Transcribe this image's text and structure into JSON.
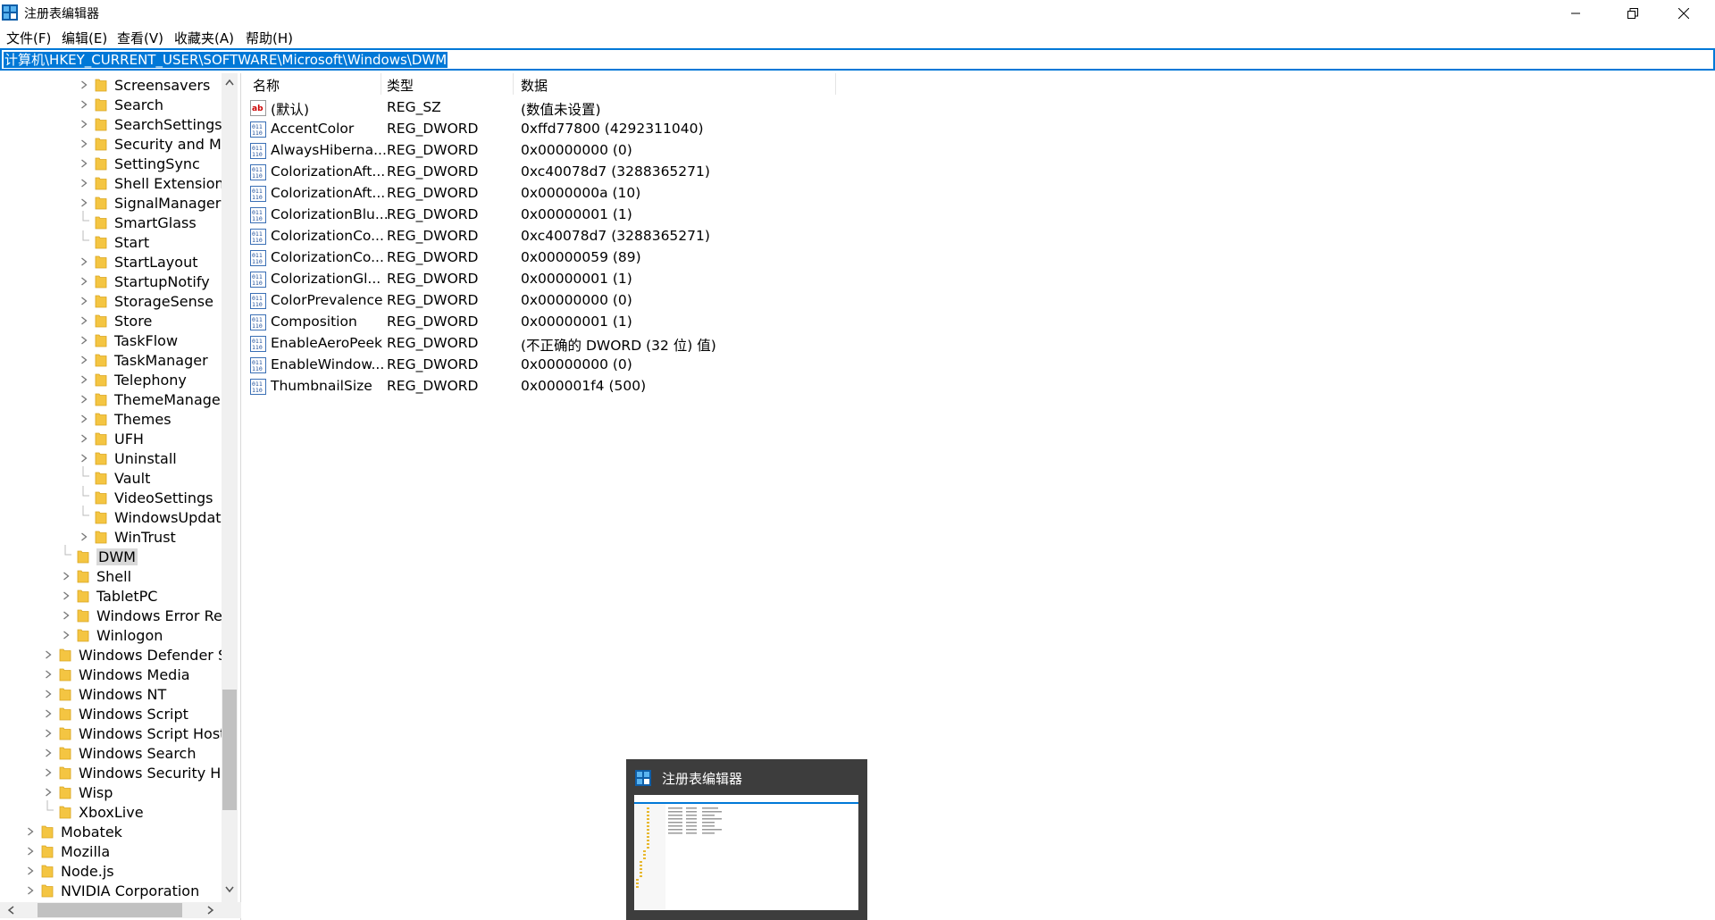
{
  "window": {
    "title": "注册表编辑器"
  },
  "menu": [
    "文件(F)",
    "编辑(E)",
    "查看(V)",
    "收藏夹(A)",
    "帮助(H)"
  ],
  "address": "计算机\\HKEY_CURRENT_USER\\SOFTWARE\\Microsoft\\Windows\\DWM",
  "tree": [
    {
      "label": "Screensavers",
      "level": 4,
      "expandable": true
    },
    {
      "label": "Search",
      "level": 4,
      "expandable": true
    },
    {
      "label": "SearchSettings",
      "level": 4,
      "expandable": true
    },
    {
      "label": "Security and Ma",
      "level": 4,
      "expandable": true
    },
    {
      "label": "SettingSync",
      "level": 4,
      "expandable": true
    },
    {
      "label": "Shell Extensions",
      "level": 4,
      "expandable": true
    },
    {
      "label": "SignalManager",
      "level": 4,
      "expandable": true
    },
    {
      "label": "SmartGlass",
      "level": 4,
      "expandable": false
    },
    {
      "label": "Start",
      "level": 4,
      "expandable": false
    },
    {
      "label": "StartLayout",
      "level": 4,
      "expandable": true
    },
    {
      "label": "StartupNotify",
      "level": 4,
      "expandable": true
    },
    {
      "label": "StorageSense",
      "level": 4,
      "expandable": true
    },
    {
      "label": "Store",
      "level": 4,
      "expandable": true
    },
    {
      "label": "TaskFlow",
      "level": 4,
      "expandable": true
    },
    {
      "label": "TaskManager",
      "level": 4,
      "expandable": true
    },
    {
      "label": "Telephony",
      "level": 4,
      "expandable": true
    },
    {
      "label": "ThemeManager",
      "level": 4,
      "expandable": true
    },
    {
      "label": "Themes",
      "level": 4,
      "expandable": true
    },
    {
      "label": "UFH",
      "level": 4,
      "expandable": true
    },
    {
      "label": "Uninstall",
      "level": 4,
      "expandable": true
    },
    {
      "label": "Vault",
      "level": 4,
      "expandable": false
    },
    {
      "label": "VideoSettings",
      "level": 4,
      "expandable": false
    },
    {
      "label": "WindowsUpdate",
      "level": 4,
      "expandable": false
    },
    {
      "label": "WinTrust",
      "level": 4,
      "expandable": true
    },
    {
      "label": "DWM",
      "level": 3,
      "expandable": false,
      "selected": true
    },
    {
      "label": "Shell",
      "level": 3,
      "expandable": true
    },
    {
      "label": "TabletPC",
      "level": 3,
      "expandable": true
    },
    {
      "label": "Windows Error Rep",
      "level": 3,
      "expandable": true
    },
    {
      "label": "Winlogon",
      "level": 3,
      "expandable": true
    },
    {
      "label": "Windows Defender Se",
      "level": 2,
      "expandable": true
    },
    {
      "label": "Windows Media",
      "level": 2,
      "expandable": true
    },
    {
      "label": "Windows NT",
      "level": 2,
      "expandable": true
    },
    {
      "label": "Windows Script",
      "level": 2,
      "expandable": true
    },
    {
      "label": "Windows Script Host",
      "level": 2,
      "expandable": true
    },
    {
      "label": "Windows Search",
      "level": 2,
      "expandable": true
    },
    {
      "label": "Windows Security He",
      "level": 2,
      "expandable": true
    },
    {
      "label": "Wisp",
      "level": 2,
      "expandable": true
    },
    {
      "label": "XboxLive",
      "level": 2,
      "expandable": false
    },
    {
      "label": "Mobatek",
      "level": 1,
      "expandable": true
    },
    {
      "label": "Mozilla",
      "level": 1,
      "expandable": true
    },
    {
      "label": "Node.js",
      "level": 1,
      "expandable": true
    },
    {
      "label": "NVIDIA Corporation",
      "level": 1,
      "expandable": true
    }
  ],
  "columns": {
    "name": "名称",
    "type": "类型",
    "data": "数据"
  },
  "values": [
    {
      "icon": "string-value-icon",
      "name": "(默认)",
      "type": "REG_SZ",
      "data": "(数值未设置)"
    },
    {
      "icon": "binary-value-icon",
      "name": "AccentColor",
      "type": "REG_DWORD",
      "data": "0xffd77800 (4292311040)"
    },
    {
      "icon": "binary-value-icon",
      "name": "AlwaysHiberna...",
      "type": "REG_DWORD",
      "data": "0x00000000 (0)"
    },
    {
      "icon": "binary-value-icon",
      "name": "ColorizationAft...",
      "type": "REG_DWORD",
      "data": "0xc40078d7 (3288365271)"
    },
    {
      "icon": "binary-value-icon",
      "name": "ColorizationAft...",
      "type": "REG_DWORD",
      "data": "0x0000000a (10)"
    },
    {
      "icon": "binary-value-icon",
      "name": "ColorizationBlu...",
      "type": "REG_DWORD",
      "data": "0x00000001 (1)"
    },
    {
      "icon": "binary-value-icon",
      "name": "ColorizationCo...",
      "type": "REG_DWORD",
      "data": "0xc40078d7 (3288365271)"
    },
    {
      "icon": "binary-value-icon",
      "name": "ColorizationCo...",
      "type": "REG_DWORD",
      "data": "0x00000059 (89)"
    },
    {
      "icon": "binary-value-icon",
      "name": "ColorizationGl...",
      "type": "REG_DWORD",
      "data": "0x00000001 (1)"
    },
    {
      "icon": "binary-value-icon",
      "name": "ColorPrevalence",
      "type": "REG_DWORD",
      "data": "0x00000000 (0)"
    },
    {
      "icon": "binary-value-icon",
      "name": "Composition",
      "type": "REG_DWORD",
      "data": "0x00000001 (1)"
    },
    {
      "icon": "binary-value-icon",
      "name": "EnableAeroPeek",
      "type": "REG_DWORD",
      "data": "(不正确的 DWORD (32 位) 值)"
    },
    {
      "icon": "binary-value-icon",
      "name": "EnableWindow...",
      "type": "REG_DWORD",
      "data": "0x00000000 (0)"
    },
    {
      "icon": "binary-value-icon",
      "name": "ThumbnailSize",
      "type": "REG_DWORD",
      "data": "0x000001f4 (500)"
    }
  ],
  "taskbar_preview": {
    "title": "注册表编辑器"
  },
  "colors": {
    "accent": "#0078d7",
    "folder": "#f4c542",
    "preview_bg": "#3d3d3d"
  }
}
